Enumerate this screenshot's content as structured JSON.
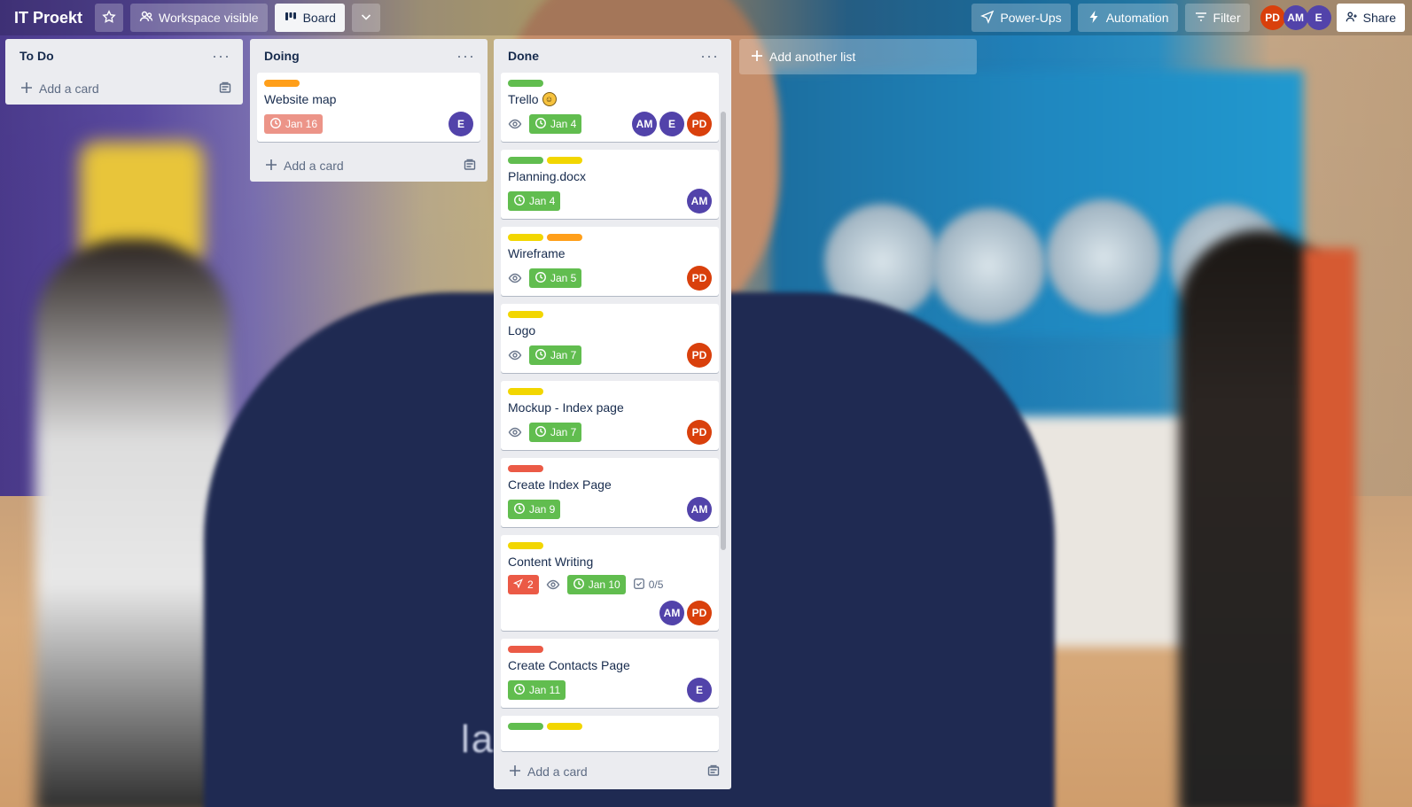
{
  "header": {
    "board_title": "IT Proekt",
    "workspace_label": "Workspace visible",
    "board_label": "Board",
    "powerups_label": "Power-Ups",
    "automation_label": "Automation",
    "filter_label": "Filter",
    "share_label": "Share",
    "members": [
      {
        "initials": "PD",
        "color": "#d9400c"
      },
      {
        "initials": "AM",
        "color": "#5243aa"
      },
      {
        "initials": "E",
        "color": "#5243aa"
      }
    ]
  },
  "lists": {
    "todo": {
      "title": "To Do",
      "add_card": "Add a card"
    },
    "doing": {
      "title": "Doing",
      "add_card": "Add a card",
      "cards": [
        {
          "title": "Website map",
          "labels": [
            "#ff9f1a"
          ],
          "due": "Jan 16",
          "members": [
            "E"
          ]
        }
      ]
    },
    "done": {
      "title": "Done",
      "add_card": "Add a card",
      "cards": [
        {
          "title": "Trello",
          "due": "Jan 4",
          "members": [
            "AM",
            "E",
            "PD"
          ]
        },
        {
          "title": "Planning.docx",
          "due": "Jan 4",
          "members": [
            "AM"
          ]
        },
        {
          "title": "Wireframe",
          "due": "Jan 5",
          "members": [
            "PD"
          ]
        },
        {
          "title": "Logo",
          "due": "Jan 7",
          "members": [
            "PD"
          ]
        },
        {
          "title": "Mockup - Index page",
          "due": "Jan 7",
          "members": [
            "PD"
          ]
        },
        {
          "title": "Create Index Page",
          "due": "Jan 9",
          "members": [
            "AM"
          ]
        },
        {
          "title": "Content Writing",
          "due": "Jan 10",
          "comments": "2",
          "checklist": "0/5",
          "members": [
            "AM",
            "PD"
          ]
        },
        {
          "title": "Create Contacts Page",
          "due": "Jan 11",
          "members": [
            "E"
          ]
        }
      ]
    }
  },
  "add_list_label": "Add another list",
  "background_text": "la         on",
  "colors": {
    "green": "#61bd4f",
    "yellow": "#f2d600",
    "orange": "#ff9f1a",
    "red": "#eb5a46",
    "overdue": "#ec9488",
    "avatar_purple": "#5243aa",
    "avatar_red": "#d9400c"
  }
}
